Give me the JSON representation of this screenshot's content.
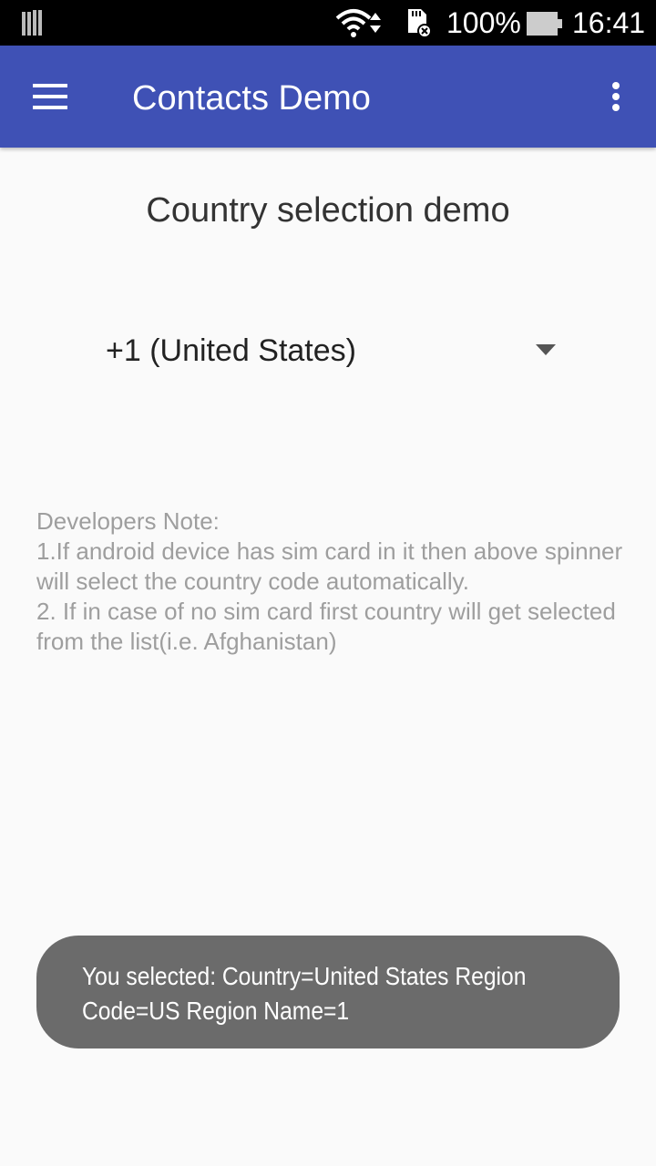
{
  "status_bar": {
    "battery": "100%",
    "time": "16:41",
    "icons": [
      "signal-bars-icon",
      "wifi-icon",
      "sd-card-error-icon",
      "battery-icon"
    ]
  },
  "app_bar": {
    "title": "Contacts Demo",
    "color": "#3f51b5",
    "icons": [
      "menu-icon",
      "overflow-menu-icon"
    ]
  },
  "main": {
    "heading": "Country selection demo",
    "spinner": {
      "selected": "+1 (United States)"
    },
    "developer_note": "Developers Note:\n1.If android device has sim card in it then above spinner will select the country code automatically.\n 2. If in case of no sim card first country will get selected from the list(i.e. Afghanistan)"
  },
  "toast": {
    "message": "You selected: Country=United States Region Code=US Region Name=1"
  }
}
